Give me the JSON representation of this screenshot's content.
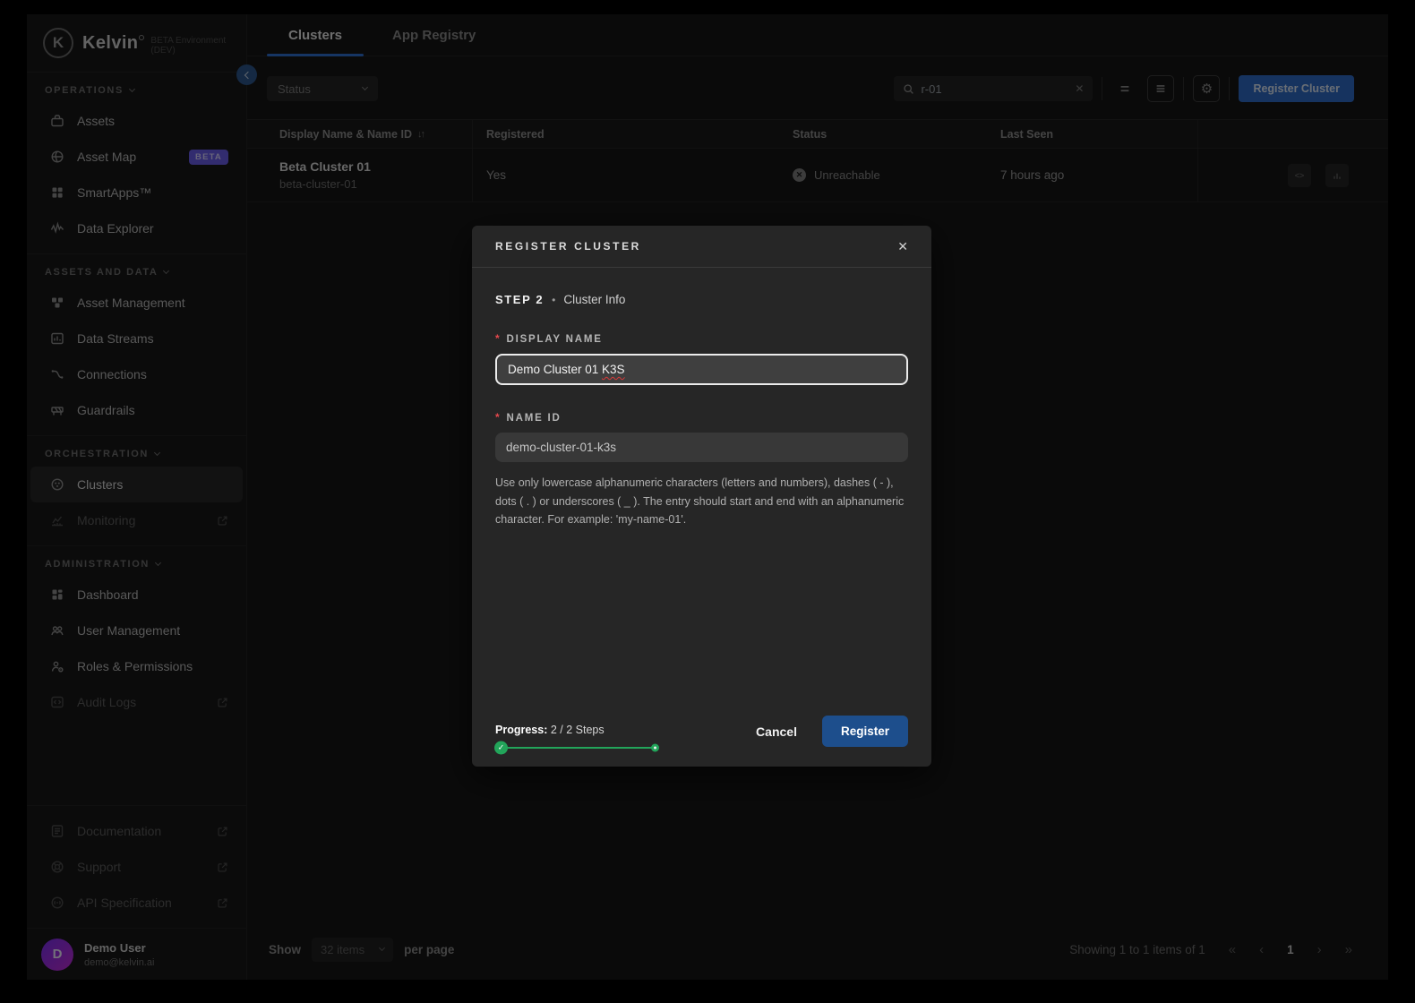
{
  "brand": {
    "logo_letter": "K",
    "name": "Kelvin",
    "env": "BETA Environment (DEV)"
  },
  "sidebar": {
    "sections": [
      {
        "label": "OPERATIONS",
        "items": [
          {
            "label": "Assets"
          },
          {
            "label": "Asset Map",
            "badge": "BETA"
          },
          {
            "label": "SmartApps™"
          },
          {
            "label": "Data Explorer"
          }
        ]
      },
      {
        "label": "ASSETS AND DATA",
        "items": [
          {
            "label": "Asset Management"
          },
          {
            "label": "Data Streams"
          },
          {
            "label": "Connections"
          },
          {
            "label": "Guardrails"
          }
        ]
      },
      {
        "label": "ORCHESTRATION",
        "items": [
          {
            "label": "Clusters"
          },
          {
            "label": "Monitoring"
          }
        ]
      },
      {
        "label": "ADMINISTRATION",
        "items": [
          {
            "label": "Dashboard"
          },
          {
            "label": "User Management"
          },
          {
            "label": "Roles & Permissions"
          },
          {
            "label": "Audit Logs"
          }
        ]
      }
    ],
    "footer_links": [
      {
        "label": "Documentation"
      },
      {
        "label": "Support"
      },
      {
        "label": "API Specification"
      }
    ],
    "user": {
      "initial": "D",
      "name": "Demo User",
      "email": "demo@kelvin.ai"
    }
  },
  "tabs": {
    "clusters": "Clusters",
    "app_registry": "App Registry"
  },
  "toolbar": {
    "status_label": "Status",
    "search_value": "r-01",
    "clear": "✕",
    "register_label": "Register Cluster"
  },
  "table": {
    "headers": {
      "name": "Display Name & Name ID",
      "sort": "↓↑",
      "registered": "Registered",
      "status": "Status",
      "last_seen": "Last Seen"
    },
    "row": {
      "name": "Beta Cluster 01",
      "id": "beta-cluster-01",
      "registered": "Yes",
      "status_x": "✕",
      "status": "Unreachable",
      "last_seen": "7 hours ago",
      "code_glyph": "<>"
    }
  },
  "footer_bar": {
    "show": "Show",
    "page_size": "32 items",
    "per_page": "per page",
    "summary": "Showing 1 to 1 items of 1",
    "first": "«",
    "prev": "‹",
    "page": "1",
    "next": "›",
    "last": "»"
  },
  "modal": {
    "title": "REGISTER CLUSTER",
    "close": "✕",
    "step_label": "STEP 2",
    "step_dot": "•",
    "step_name": "Cluster Info",
    "display_name": {
      "required": "*",
      "label": "DISPLAY NAME",
      "value_prefix": "Demo Cluster 01 ",
      "value_flagged": "K3S"
    },
    "name_id": {
      "required": "*",
      "label": "NAME ID",
      "value": "demo-cluster-01-k3s",
      "helper": "Use only lowercase alphanumeric characters (letters and numbers), dashes ( - ), dots ( . ) or underscores ( _ ). The entry should start and end with an alphanumeric character. For example: 'my-name-01'."
    },
    "progress_label": "Progress:",
    "progress_value": " 2 / 2 Steps",
    "check": "✓",
    "cancel": "Cancel",
    "submit": "Register"
  },
  "colors": {
    "accent_blue": "#2f6fd0",
    "register_blue": "#1d4e8c",
    "progress_green": "#22a55a",
    "beta_purple": "#6a5ce8",
    "error_red": "#e5484d"
  }
}
